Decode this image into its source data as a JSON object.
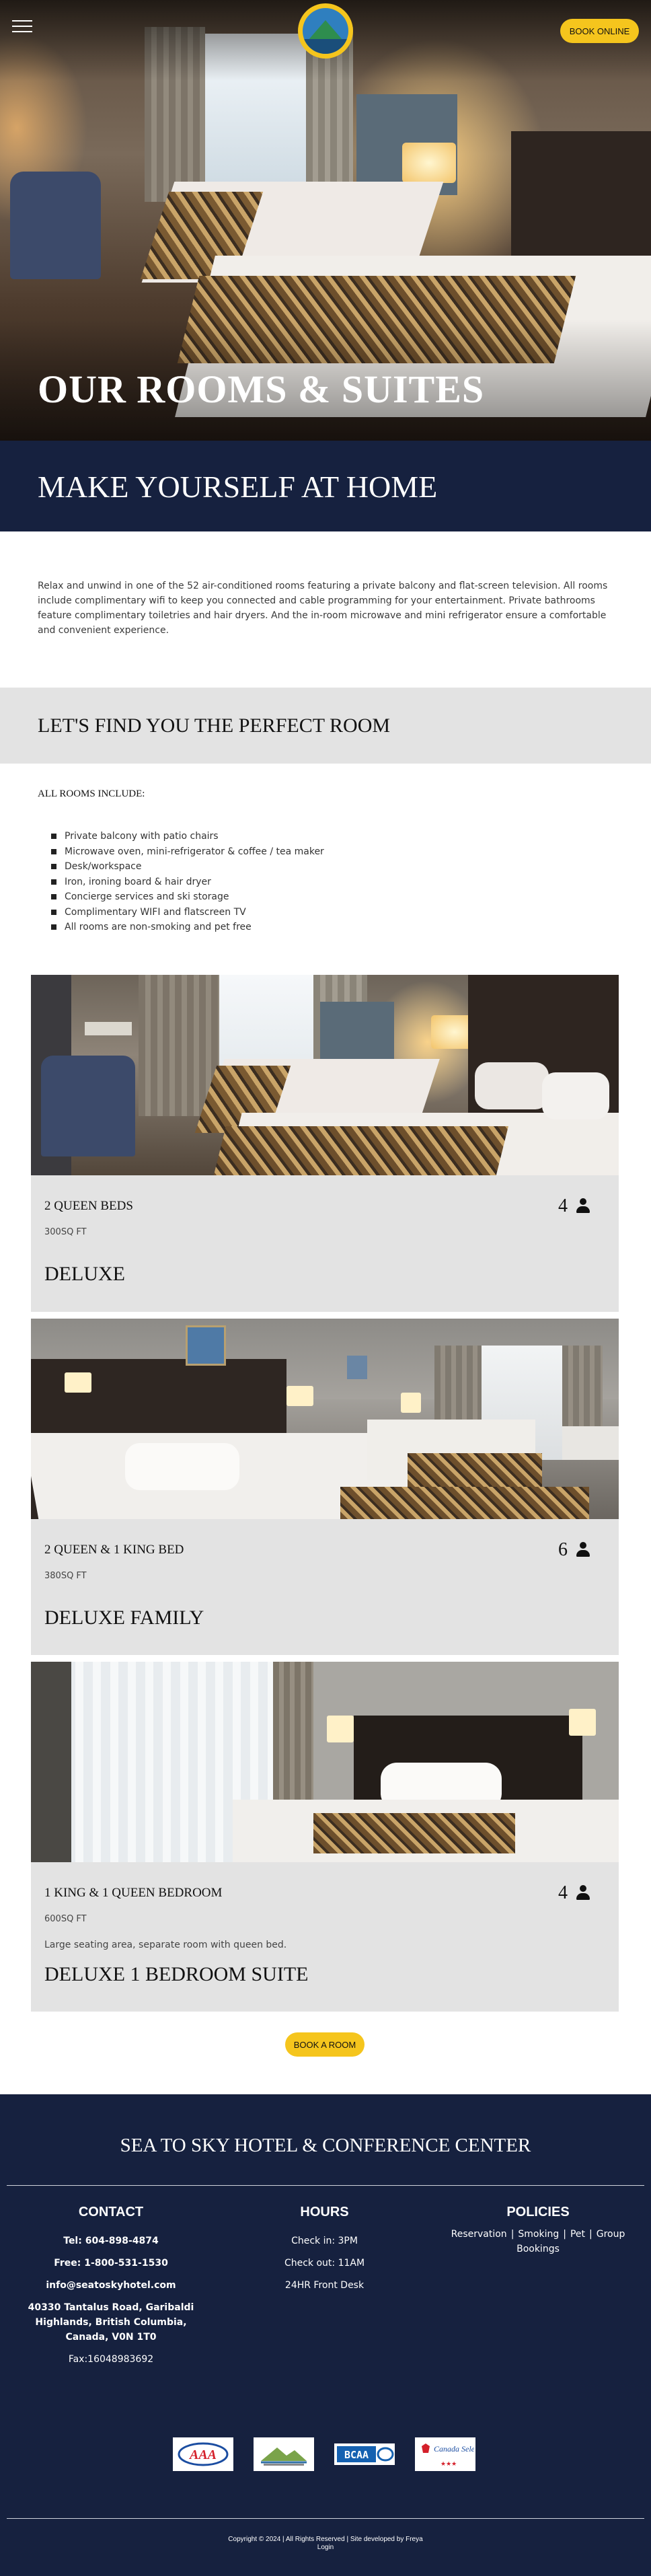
{
  "header": {
    "menu_icon": "hamburger-menu-icon",
    "logo": "sea-to-sky-hotel-logo",
    "book_online": "BOOK ONLINE"
  },
  "hero": {
    "title": "OUR ROOMS & SUITES"
  },
  "subhero": {
    "title": "MAKE YOURSELF AT HOME"
  },
  "intro": {
    "text": "Relax and unwind in one of the 52 air-conditioned rooms featuring a private balcony and flat-screen television. All rooms include complimentary wifi to keep you connected and cable programming for your entertainment. Private bathrooms feature complimentary toiletries and hair dryers. And the in-room microwave and mini refrigerator ensure a comfortable and convenient experience."
  },
  "find": {
    "title": "LET'S FIND YOU THE PERFECT ROOM"
  },
  "includes": {
    "heading": "ALL ROOMS INCLUDE:",
    "items": [
      "Private balcony with patio chairs",
      "Microwave oven, mini-refrigerator & coffee / tea maker",
      "Desk/workspace",
      "Iron, ironing board & hair dryer",
      "Concierge services and ski storage",
      "Complimentary WIFI and flatscreen TV",
      "All rooms are non-smoking and pet free"
    ]
  },
  "rooms": [
    {
      "beds": "2 QUEEN BEDS",
      "sqft": "300SQ FT",
      "guests": "4",
      "name": "DELUXE",
      "desc": ""
    },
    {
      "beds": "2 QUEEN & 1 KING BED",
      "sqft": "380SQ FT",
      "guests": "6",
      "name": "DELUXE FAMILY",
      "desc": ""
    },
    {
      "beds": "1 KING & 1 QUEEN BEDROOM",
      "sqft": "600SQ FT",
      "guests": "4",
      "name": "DELUXE 1 BEDROOM SUITE",
      "desc": "Large seating area, separate room with queen bed."
    }
  ],
  "book_room": "BOOK A ROOM",
  "footer": {
    "title": "SEA TO SKY HOTEL & CONFERENCE CENTER",
    "contact": {
      "heading": "CONTACT",
      "tel": "Tel: 604-898-4874",
      "free": "Free: 1-800-531-1530",
      "email": "info@seatoskyhotel.com",
      "address": "40330 Tantalus Road, Garibaldi Highlands, British Columbia, Canada, V0N 1T0",
      "fax": "Fax:16048983692"
    },
    "hours": {
      "heading": "HOURS",
      "checkin": "Check in: 3PM",
      "checkout": "Check out: 11AM",
      "desk": "24HR Front Desk"
    },
    "policies": {
      "heading": "POLICIES",
      "links": [
        "Reservation",
        "Smoking",
        "Pet",
        "Group Bookings"
      ]
    },
    "badges": {
      "aaa": "AAA",
      "canada_select": "Canada Select",
      "bcaa": "BCAA"
    },
    "copyright_line1": "Copyright © 2024 | All Rights Reserved | Site developed by Freya",
    "copyright_line2": "Login"
  },
  "colors": {
    "navy": "#16213f",
    "yellow": "#f5c51d",
    "gray_band": "#e3e3e3"
  }
}
